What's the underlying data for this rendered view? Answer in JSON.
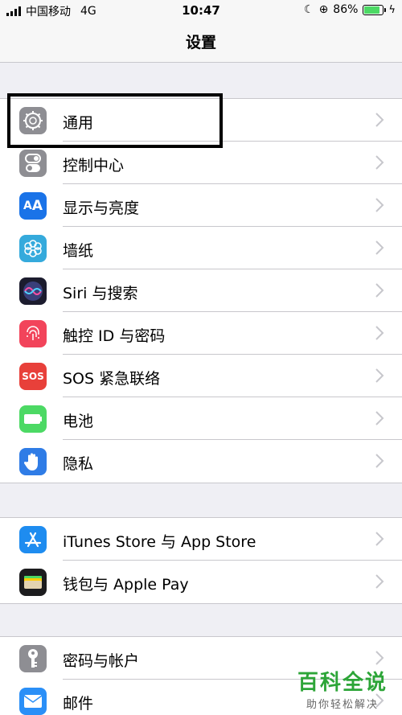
{
  "status_bar": {
    "carrier": "中国移动",
    "network": "4G",
    "time": "10:47",
    "battery": "86%"
  },
  "nav": {
    "title": "设置"
  },
  "colors": {
    "chevron": "#c7c7cc",
    "highlight": "#000000",
    "watermark": "#2da538"
  },
  "groups": [
    {
      "items": [
        {
          "label": "通用",
          "icon": "gear-icon",
          "color": "#8e8e93"
        },
        {
          "label": "控制中心",
          "icon": "toggle-icon",
          "color": "#8e8e93"
        },
        {
          "label": "显示与亮度",
          "icon": "text-size-icon",
          "color": "#1a73e8"
        },
        {
          "label": "墙纸",
          "icon": "flower-icon",
          "color": "#35aadc"
        },
        {
          "label": "Siri 与搜索",
          "icon": "siri-icon",
          "color": "#1c1c2e"
        },
        {
          "label": "触控 ID 与密码",
          "icon": "fingerprint-icon",
          "color": "#f2445b"
        },
        {
          "label": "SOS 紧急联络",
          "icon": "sos-icon",
          "color": "#e8403a",
          "text": "SOS"
        },
        {
          "label": "电池",
          "icon": "battery-icon",
          "color": "#4cd964"
        },
        {
          "label": "隐私",
          "icon": "hand-icon",
          "color": "#2f7ce6"
        }
      ]
    },
    {
      "items": [
        {
          "label": "iTunes Store 与 App Store",
          "icon": "app-store-icon",
          "color": "#1e8cf0"
        },
        {
          "label": "钱包与 Apple Pay",
          "icon": "wallet-icon",
          "color": "#1c1c1e"
        }
      ]
    },
    {
      "items": [
        {
          "label": "密码与帐户",
          "icon": "key-icon",
          "color": "#8e8e93"
        },
        {
          "label": "邮件",
          "icon": "mail-icon",
          "color": "#2a8ff7"
        }
      ]
    }
  ],
  "watermark": {
    "title": "百科全说",
    "subtitle": "助你轻松解决"
  }
}
